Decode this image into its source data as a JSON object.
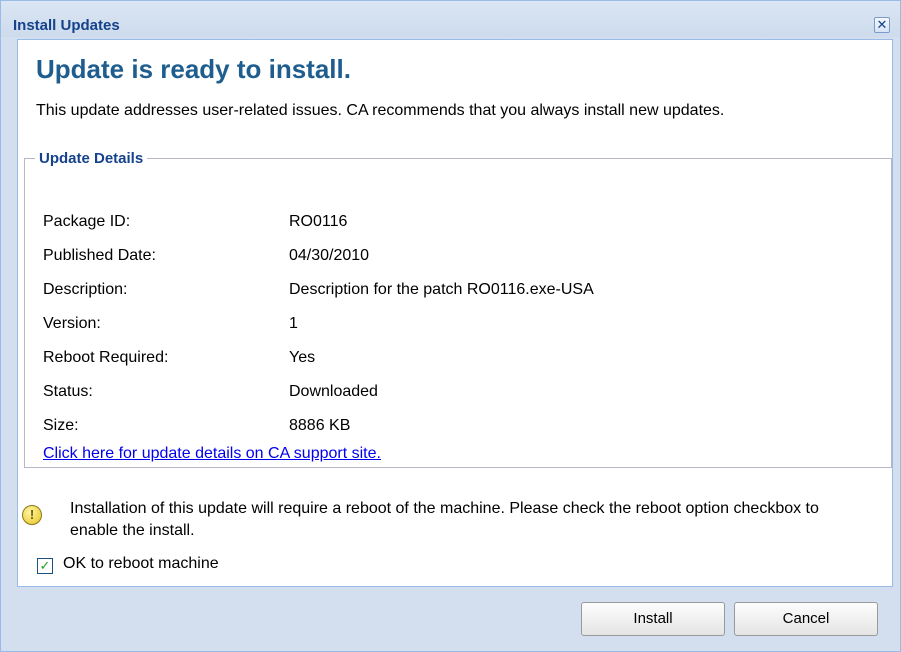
{
  "window": {
    "title": "Install Updates",
    "close_symbol": "✕",
    "close_icon": "close-icon"
  },
  "main": {
    "heading": "Update is ready to install.",
    "intro": "This update addresses user-related issues. CA recommends that you always install new updates."
  },
  "details": {
    "legend": "Update Details",
    "rows": [
      {
        "label": "Package ID:",
        "value": "RO0116"
      },
      {
        "label": "Published Date:",
        "value": "04/30/2010"
      },
      {
        "label": "Description:",
        "value": "Description for the patch RO0116.exe-USA"
      },
      {
        "label": "Version:",
        "value": "1"
      },
      {
        "label": "Reboot Required:",
        "value": "Yes"
      },
      {
        "label": "Status:",
        "value": "Downloaded"
      },
      {
        "label": "Size:",
        "value": "8886 KB"
      }
    ],
    "support_link": "Click here for update details on CA support site."
  },
  "warning": {
    "icon": "warning-icon",
    "text": "Installation of this update will require a reboot of the machine. Please check the reboot option checkbox to enable the install."
  },
  "reboot": {
    "checked": true,
    "check_symbol": "✓",
    "label": "OK to reboot machine"
  },
  "buttons": {
    "install": "Install",
    "cancel": "Cancel"
  },
  "colors": {
    "title_text": "#15428b",
    "heading_text": "#1e5d8e",
    "dialog_background": "#d3dfee",
    "link": "#0000ee",
    "checkmark": "#21a121"
  }
}
